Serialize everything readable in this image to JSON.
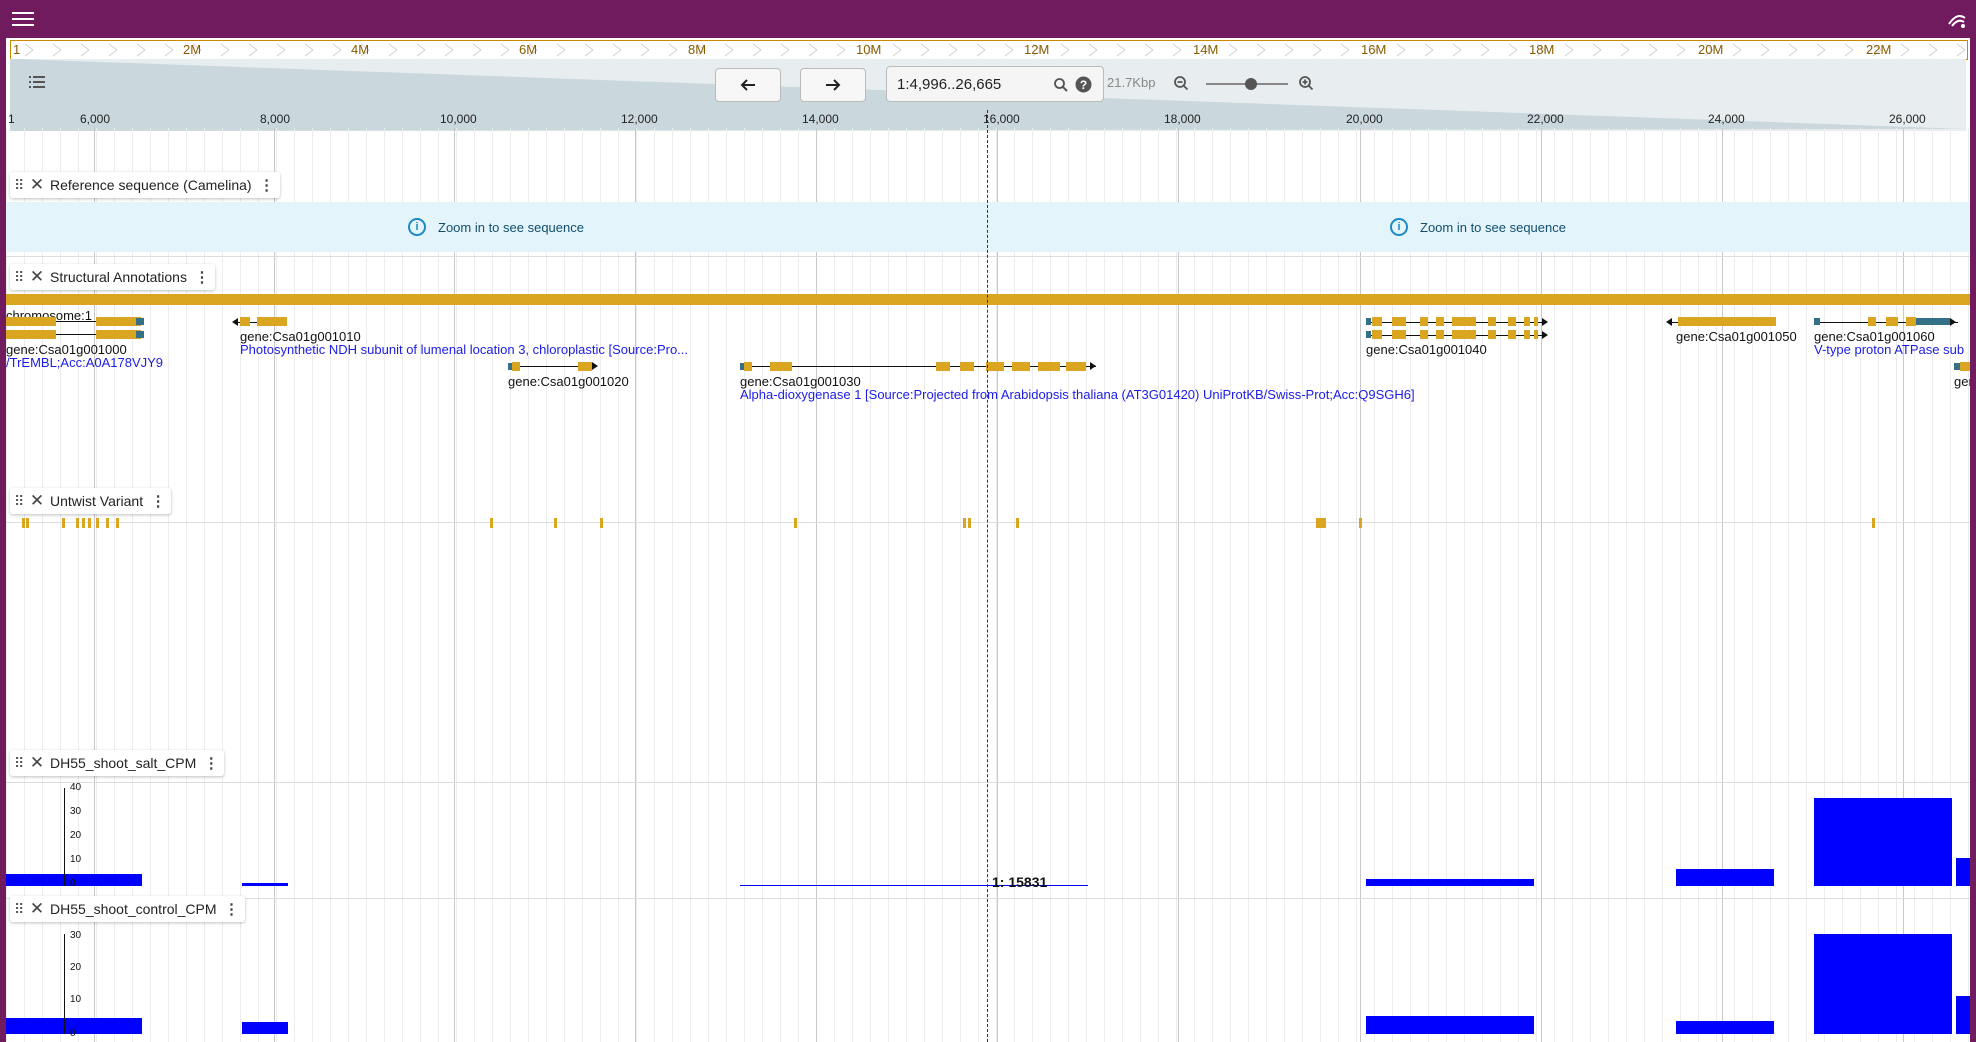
{
  "app": {
    "menu_icon": "hamburger-menu-icon",
    "logo_icon": "jbrowse-logo-icon",
    "brand_color": "#711b5f"
  },
  "overview": {
    "ticks": [
      "1",
      "2M",
      "4M",
      "6M",
      "8M",
      "10M",
      "12M",
      "14M",
      "16M",
      "18M",
      "20M",
      "22M"
    ]
  },
  "controls": {
    "back_icon": "arrow-left-icon",
    "forward_icon": "arrow-right-icon",
    "location_value": "1:4,996..26,665",
    "search_icon": "search-icon",
    "help_icon": "help-icon",
    "bp_label": "21.7Kbp",
    "zoom_out_icon": "zoom-out-icon",
    "zoom_in_icon": "zoom-in-icon",
    "zoom_level": 0.55,
    "track_selector_icon": "track-list-icon"
  },
  "scale": {
    "labels": [
      "1",
      "6,000",
      "8,000",
      "10,000",
      "12,000",
      "14,000",
      "16,000",
      "18,000",
      "20,000",
      "22,000",
      "24,000",
      "26,000"
    ]
  },
  "tracks": {
    "reference": {
      "name": "Reference sequence (Camelina)",
      "message_left": "Zoom in to see sequence",
      "message_right": "Zoom in to see sequence"
    },
    "structural": {
      "name": "Structural Annotations",
      "chromosome_label": "chromosome:1",
      "genes": [
        {
          "label": "gene:Csa01g001000",
          "desc": "/TrEMBL;Acc:A0A178VJY9"
        },
        {
          "label": "gene:Csa01g001010",
          "desc": "Photosynthetic NDH subunit of lumenal location 3, chloroplastic [Source:Pro..."
        },
        {
          "label": "gene:Csa01g001020",
          "desc": ""
        },
        {
          "label": "gene:Csa01g001030",
          "desc": "Alpha-dioxygenase 1 [Source:Projected from Arabidopsis thaliana (AT3G01420) UniProtKB/Swiss-Prot;Acc:Q9SGH6]"
        },
        {
          "label": "gene:Csa01g001040",
          "desc": ""
        },
        {
          "label": "gene:Csa01g001050",
          "desc": ""
        },
        {
          "label": "gene:Csa01g001060",
          "desc": "V-type proton ATPase sub"
        },
        {
          "label": "gen",
          "desc": ""
        }
      ]
    },
    "variant": {
      "name": "Untwist Variant"
    },
    "salt": {
      "name": "DH55_shoot_salt_CPM",
      "axis_ticks": [
        "40",
        "30",
        "20",
        "10",
        "0"
      ]
    },
    "control": {
      "name": "DH55_shoot_control_CPM",
      "axis_ticks": [
        "30",
        "20",
        "10",
        "0"
      ]
    }
  },
  "cursor": {
    "readout": "1: 15831"
  },
  "colors": {
    "feature": "#daa520",
    "utr": "#357089",
    "coverage": "#0000ff",
    "desc_text": "#1c1ce6",
    "info_bg": "#e3f4fb"
  }
}
